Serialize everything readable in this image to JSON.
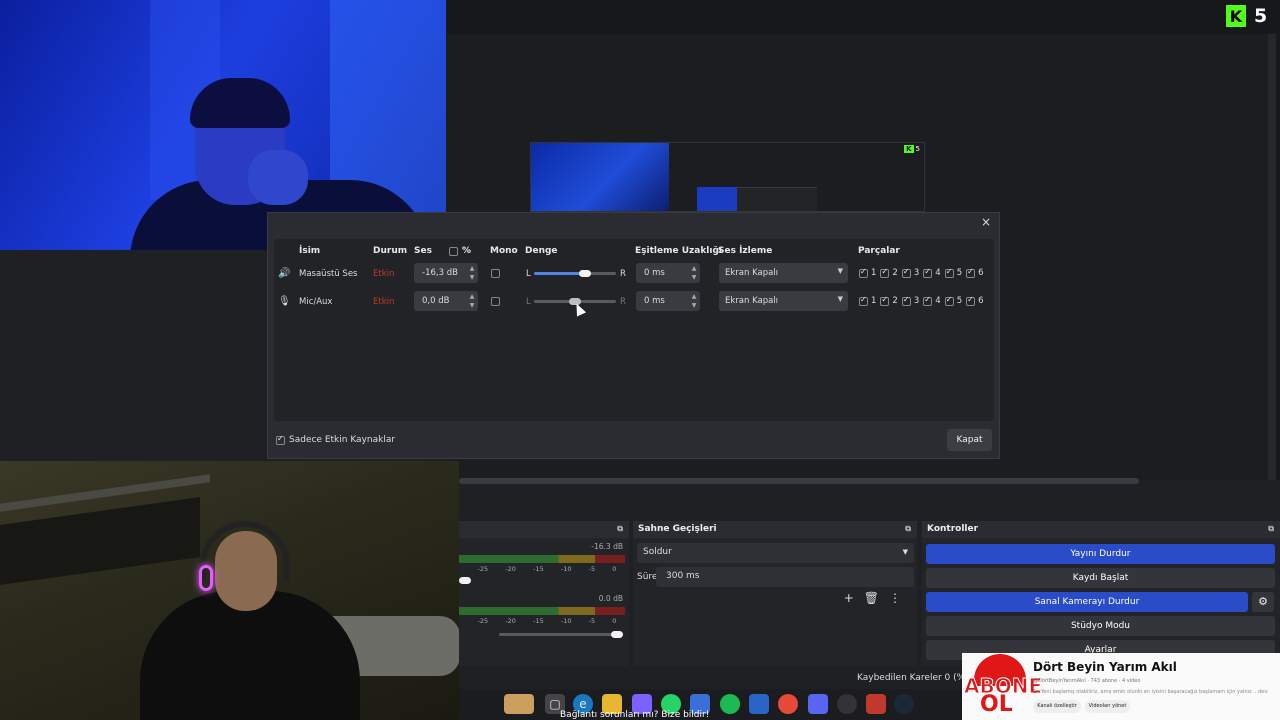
{
  "kick": {
    "letter": "K",
    "number": "5"
  },
  "audio_dialog": {
    "headers": {
      "name": "İsim",
      "status": "Durum",
      "volume": "Ses",
      "percent": "%",
      "mono": "Mono",
      "balance": "Denge",
      "sync_offset": "Eşitleme Uzaklığı",
      "monitoring": "Ses İzleme",
      "tracks": "Parçalar"
    },
    "rows": [
      {
        "name": "Masaüstü Ses",
        "status": "Etkin",
        "volume": "-16,3 dB",
        "balance_left": "L",
        "balance_right": "R",
        "balance_value": 0.62,
        "sync": "0 ms",
        "monitoring": "Ekran Kapalı",
        "icon": "speaker-icon"
      },
      {
        "name": "Mic/Aux",
        "status": "Etkin",
        "volume": "0,0 dB",
        "balance_left": "L",
        "balance_right": "R",
        "balance_value": 0.5,
        "sync": "0 ms",
        "monitoring": "Ekran Kapalı",
        "icon": "microphone-icon"
      }
    ],
    "track_labels": [
      "1",
      "2",
      "3",
      "4",
      "5",
      "6"
    ],
    "only_active_label": "Sadece Etkin Kaynaklar",
    "close_label": "Kapat",
    "close_icon": "×"
  },
  "mixer": {
    "desktop_db": "-16.3 dB",
    "mic_db": "0.0 dB",
    "ticks": [
      "-25",
      "-20",
      "-15",
      "-10",
      "-5",
      "0"
    ]
  },
  "transitions": {
    "title": "Sahne Geçişleri",
    "selected": "Soldur",
    "duration_label": "Süre",
    "duration_value": "300 ms"
  },
  "controls": {
    "title": "Kontroller",
    "stop_stream": "Yayını Durdur",
    "start_recording": "Kaydı Başlat",
    "stop_virtual_cam": "Sanal Kamerayı Durdur",
    "studio_mode": "Stüdyo Modu",
    "settings": "Ayarlar"
  },
  "status": {
    "dropped_frames": "Kaybedilen Kareler 0 (%0.0)"
  },
  "taskbar": {
    "tooltip": "Bağlantı sorunları mı? Bize bildir!"
  },
  "youtube_banner": {
    "abone": "ABONE",
    "ol": "OL",
    "channel_name": "Dört Beyin Yarım Akıl",
    "handle": "@DörtBeyinYarımAkıl · 743 abone · 4 video",
    "description": "En Yeni başlamış olabiliriz, ama emin olunki en iyisini başaracağız başlamam için yalnız ...devamı",
    "customize": "Kanalı özelleştir",
    "manage_videos": "Videoları yönet"
  },
  "colors": {
    "accent_blue": "#2a4cc8",
    "kick_green": "#53fc18",
    "status_red": "#c0392b",
    "youtube_red": "#e01717"
  }
}
